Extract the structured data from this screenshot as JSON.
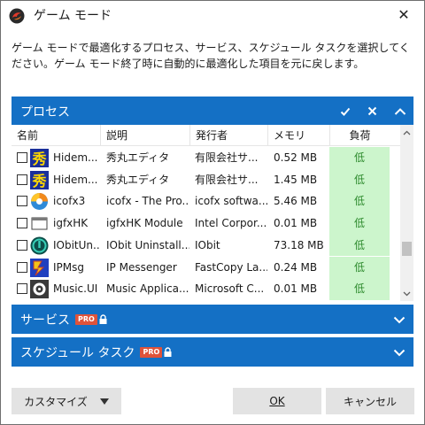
{
  "window": {
    "title": "ゲーム モード",
    "close_glyph": "✕"
  },
  "description": "ゲーム モードで最適化するプロセス、サービス、スケジュール タスクを選択してください。ゲーム モード終了時に自動的に最適化した項目を元に戻します。",
  "process_panel": {
    "title": "プロセス",
    "columns": {
      "name": "名前",
      "desc": "説明",
      "publisher": "発行者",
      "memory": "メモリ",
      "load": "負荷"
    },
    "rows": [
      {
        "name": "Hidem...",
        "desc": "秀丸エディタ",
        "publisher": "有限会社サ...",
        "memory": "0.52 MB",
        "load": "低",
        "icon": "hidemaru-icon",
        "checked": false
      },
      {
        "name": "Hidem...",
        "desc": "秀丸エディタ",
        "publisher": "有限会社サ...",
        "memory": "1.45 MB",
        "load": "低",
        "icon": "hidemaru-icon",
        "checked": false
      },
      {
        "name": "icofx3",
        "desc": "icofx - The Pro...",
        "publisher": "icofx softwa...",
        "memory": "5.46 MB",
        "load": "低",
        "icon": "icofx-icon",
        "checked": false
      },
      {
        "name": "igfxHK",
        "desc": "igfxHK Module",
        "publisher": "Intel Corpor...",
        "memory": "0.01 MB",
        "load": "低",
        "icon": "window-icon",
        "checked": false
      },
      {
        "name": "IObitUn...",
        "desc": "IObit Uninstall...",
        "publisher": "IObit",
        "memory": "73.18 MB",
        "load": "低",
        "icon": "iobit-uninstaller-icon",
        "checked": false
      },
      {
        "name": "IPMsg",
        "desc": "IP Messenger",
        "publisher": "FastCopy La...",
        "memory": "0.24 MB",
        "load": "低",
        "icon": "ipmsg-icon",
        "checked": false
      },
      {
        "name": "Music.UI",
        "desc": "Music Applica...",
        "publisher": "Microsoft C...",
        "memory": "0.01 MB",
        "load": "低",
        "icon": "music-icon",
        "checked": false
      }
    ]
  },
  "services_panel": {
    "title": "サービス",
    "badge": "PRO"
  },
  "tasks_panel": {
    "title": "スケジュール タスク",
    "badge": "PRO"
  },
  "buttons": {
    "customize": "カスタマイズ",
    "ok": "OK",
    "cancel": "キャンセル"
  },
  "colors": {
    "accent": "#1470c5",
    "load_bg": "#ccf5cc",
    "load_text": "#2d8a2d",
    "pro_badge": "#e0533a"
  }
}
